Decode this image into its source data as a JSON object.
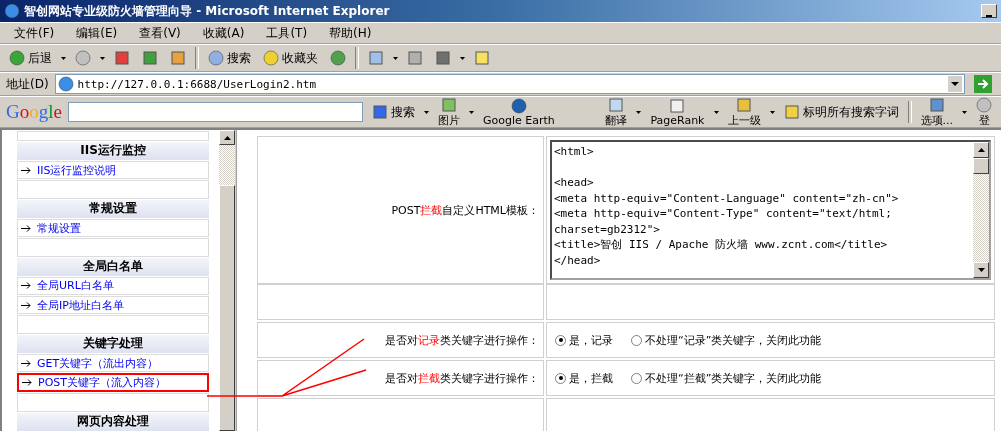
{
  "window": {
    "title": "智创网站专业级防火墙管理向导 - Microsoft Internet Explorer"
  },
  "menu": [
    "文件(F)",
    "编辑(E)",
    "查看(V)",
    "收藏(A)",
    "工具(T)",
    "帮助(H)"
  ],
  "toolbar": {
    "back": "后退",
    "search": "搜索",
    "favorites": "收藏夹"
  },
  "address": {
    "label": "地址(D)",
    "url": "http://127.0.0.1:6688/UserLogin2.htm"
  },
  "google_bar": {
    "logo": "Google",
    "search": "搜索",
    "images": "图片",
    "earth": "Google Earth",
    "translate": "翻译",
    "pagerank": "PageRank",
    "up": "上一级",
    "highlight": "标明所有搜索字词",
    "options": "选项...",
    "login": "登"
  },
  "sidebar": {
    "sections": [
      {
        "title": "IIS运行监控",
        "links": [
          {
            "label": "IIS运行监控说明",
            "highlighted": false
          }
        ]
      },
      {
        "title": "常规设置",
        "links": [
          {
            "label": "常规设置",
            "highlighted": false
          }
        ]
      },
      {
        "title": "全局白名单",
        "links": [
          {
            "label": "全局URL白名单",
            "highlighted": false
          },
          {
            "label": "全局IP地址白名单",
            "highlighted": false
          }
        ]
      },
      {
        "title": "关键字处理",
        "links": [
          {
            "label": "GET关键字（流出内容）",
            "highlighted": false
          },
          {
            "label": "POST关键字（流入内容）",
            "highlighted": true
          }
        ]
      },
      {
        "title": "网页内容处理"
      }
    ]
  },
  "form": {
    "template": {
      "label_parts": [
        {
          "text": "POST",
          "highlight": false
        },
        {
          "text": "拦截",
          "highlight": true
        },
        {
          "text": "自定义HTML模板：",
          "highlight": false
        }
      ],
      "code": "<html>\n\n<head>\n<meta http-equiv=\"Content-Language\" content=\"zh-cn\">\n<meta http-equiv=\"Content-Type\" content=\"text/html; charset=gb2312\">\n<title>智创 IIS / Apache 防火墙 www.zcnt.com</title>\n</head>"
    },
    "options": [
      {
        "label_parts": [
          {
            "text": "是否对",
            "highlight": false
          },
          {
            "text": "记录",
            "highlight": true
          },
          {
            "text": "类关键字进行操作：",
            "highlight": false
          }
        ],
        "choices": [
          {
            "label": "是，记录",
            "selected": true
          },
          {
            "label": "不处理“记录”类关键字，关闭此功能",
            "selected": false
          }
        ]
      },
      {
        "label_parts": [
          {
            "text": "是否对",
            "highlight": false
          },
          {
            "text": "拦截",
            "highlight": true
          },
          {
            "text": "类关键字进行操作：",
            "highlight": false
          }
        ],
        "choices": [
          {
            "label": "是，拦截",
            "selected": true
          },
          {
            "label": "不处理“拦截”类关键字，关闭此功能",
            "selected": false
          }
        ]
      }
    ]
  }
}
